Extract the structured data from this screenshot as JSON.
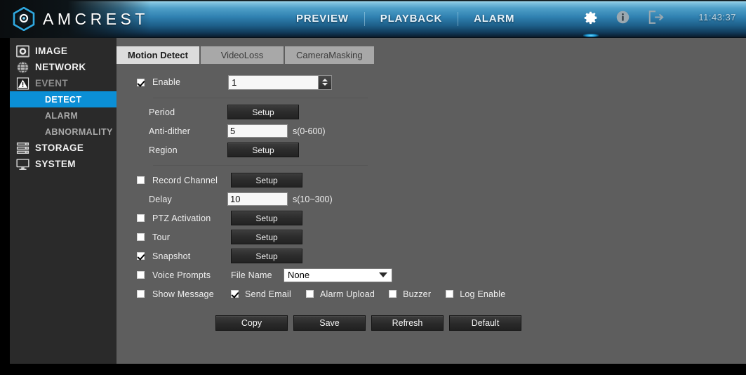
{
  "header": {
    "brand": "AMCREST",
    "brand_icon": "amcrest-hex-camera-logo",
    "nav": [
      {
        "label": "PREVIEW"
      },
      {
        "label": "PLAYBACK"
      },
      {
        "label": "ALARM"
      }
    ],
    "icons": [
      {
        "name": "gear-icon",
        "active": true
      },
      {
        "name": "info-icon",
        "active": false
      },
      {
        "name": "logout-icon",
        "active": false
      }
    ],
    "clock": "11:43:37",
    "accent_color": "#0b8fd6"
  },
  "sidebar": {
    "items": [
      {
        "label": "IMAGE",
        "icon": "camera-lens-icon",
        "state": "normal"
      },
      {
        "label": "NETWORK",
        "icon": "network-globe-icon",
        "state": "normal"
      },
      {
        "label": "EVENT",
        "icon": "warning-triangle-icon",
        "state": "expanded"
      },
      {
        "label": "STORAGE",
        "icon": "server-stack-icon",
        "state": "normal"
      },
      {
        "label": "SYSTEM",
        "icon": "monitor-icon",
        "state": "normal"
      }
    ],
    "event_subitems": [
      {
        "label": "DETECT",
        "selected": true
      },
      {
        "label": "ALARM",
        "selected": false
      },
      {
        "label": "ABNORMALITY",
        "selected": false
      }
    ]
  },
  "tabs": [
    {
      "label": "Motion Detect",
      "active": true
    },
    {
      "label": "VideoLoss",
      "active": false
    },
    {
      "label": "CameraMasking",
      "active": false
    }
  ],
  "form": {
    "enable": {
      "label": "Enable",
      "checked": true,
      "channel_value": "1"
    },
    "period": {
      "label": "Period",
      "button": "Setup"
    },
    "anti_dither": {
      "label": "Anti-dither",
      "value": "5",
      "hint": "s(0-600)"
    },
    "region": {
      "label": "Region",
      "button": "Setup"
    },
    "record_channel": {
      "label": "Record Channel",
      "checked": false,
      "button": "Setup"
    },
    "delay": {
      "label": "Delay",
      "value": "10",
      "hint": "s(10~300)"
    },
    "ptz_activation": {
      "label": "PTZ Activation",
      "checked": false,
      "button": "Setup"
    },
    "tour": {
      "label": "Tour",
      "checked": false,
      "button": "Setup"
    },
    "snapshot": {
      "label": "Snapshot",
      "checked": true,
      "button": "Setup"
    },
    "voice_prompts": {
      "label": "Voice Prompts",
      "checked": false
    },
    "file_name": {
      "label": "File Name",
      "selected": "None"
    },
    "show_message": {
      "label": "Show Message",
      "checked": false
    },
    "send_email": {
      "label": "Send Email",
      "checked": true
    },
    "alarm_upload": {
      "label": "Alarm Upload",
      "checked": false
    },
    "buzzer": {
      "label": "Buzzer",
      "checked": false
    },
    "log_enable": {
      "label": "Log Enable",
      "checked": false
    }
  },
  "actions": [
    {
      "label": "Copy"
    },
    {
      "label": "Save"
    },
    {
      "label": "Refresh"
    },
    {
      "label": "Default"
    }
  ]
}
